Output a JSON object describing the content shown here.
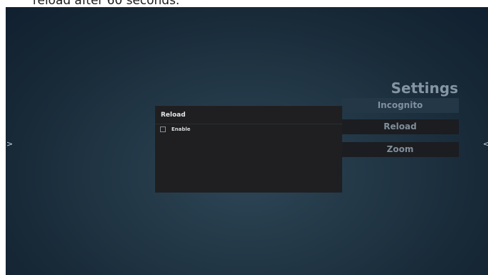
{
  "caption": "reload after 60 seconds.",
  "nav": {
    "left_arrow": ">",
    "right_arrow": "<"
  },
  "settings": {
    "title": "Settings",
    "items": [
      {
        "label": "Incognito"
      },
      {
        "label": "Reload"
      },
      {
        "label": "Zoom"
      }
    ]
  },
  "dialog": {
    "title": "Reload",
    "option": {
      "label": "Enable",
      "checked": false
    }
  }
}
